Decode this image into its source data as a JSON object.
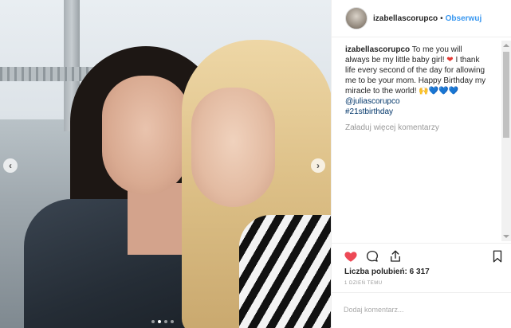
{
  "post": {
    "carousel": {
      "prev_icon": "chevron-left-icon",
      "next_icon": "chevron-right-icon",
      "prev_glyph": "‹",
      "next_glyph": "›",
      "slide_count": 4,
      "active_index": 1
    },
    "header": {
      "username": "izabellascorupco",
      "separator": "•",
      "follow_label": "Obserwuj"
    },
    "caption": {
      "username": "izabellascorupco",
      "text_part1": "To me you will always be my little baby girl!",
      "heart": "❤",
      "text_part2": "I thank life every second of the day for allowing me to be your mom. Happy Birthday my miracle to the world!",
      "emoji_hands": "🙌",
      "emoji_hearts": "💙💙💙",
      "mention": "@juliascorupco",
      "hashtag": "#21stbirthday"
    },
    "load_more_label": "Załaduj więcej komentarzy",
    "actions": {
      "like_icon": "heart-filled-icon",
      "comment_icon": "comment-bubble-icon",
      "share_icon": "share-icon",
      "save_icon": "bookmark-icon",
      "like_color": "#ed4956"
    },
    "likes_text": "Liczba polubień: 6 317",
    "time_ago": "1 DZIEŃ TEMU",
    "comment_placeholder": "Dodaj komentarz..."
  },
  "colors": {
    "follow_blue": "#3897f0",
    "border": "#efefef",
    "muted": "#999999"
  }
}
